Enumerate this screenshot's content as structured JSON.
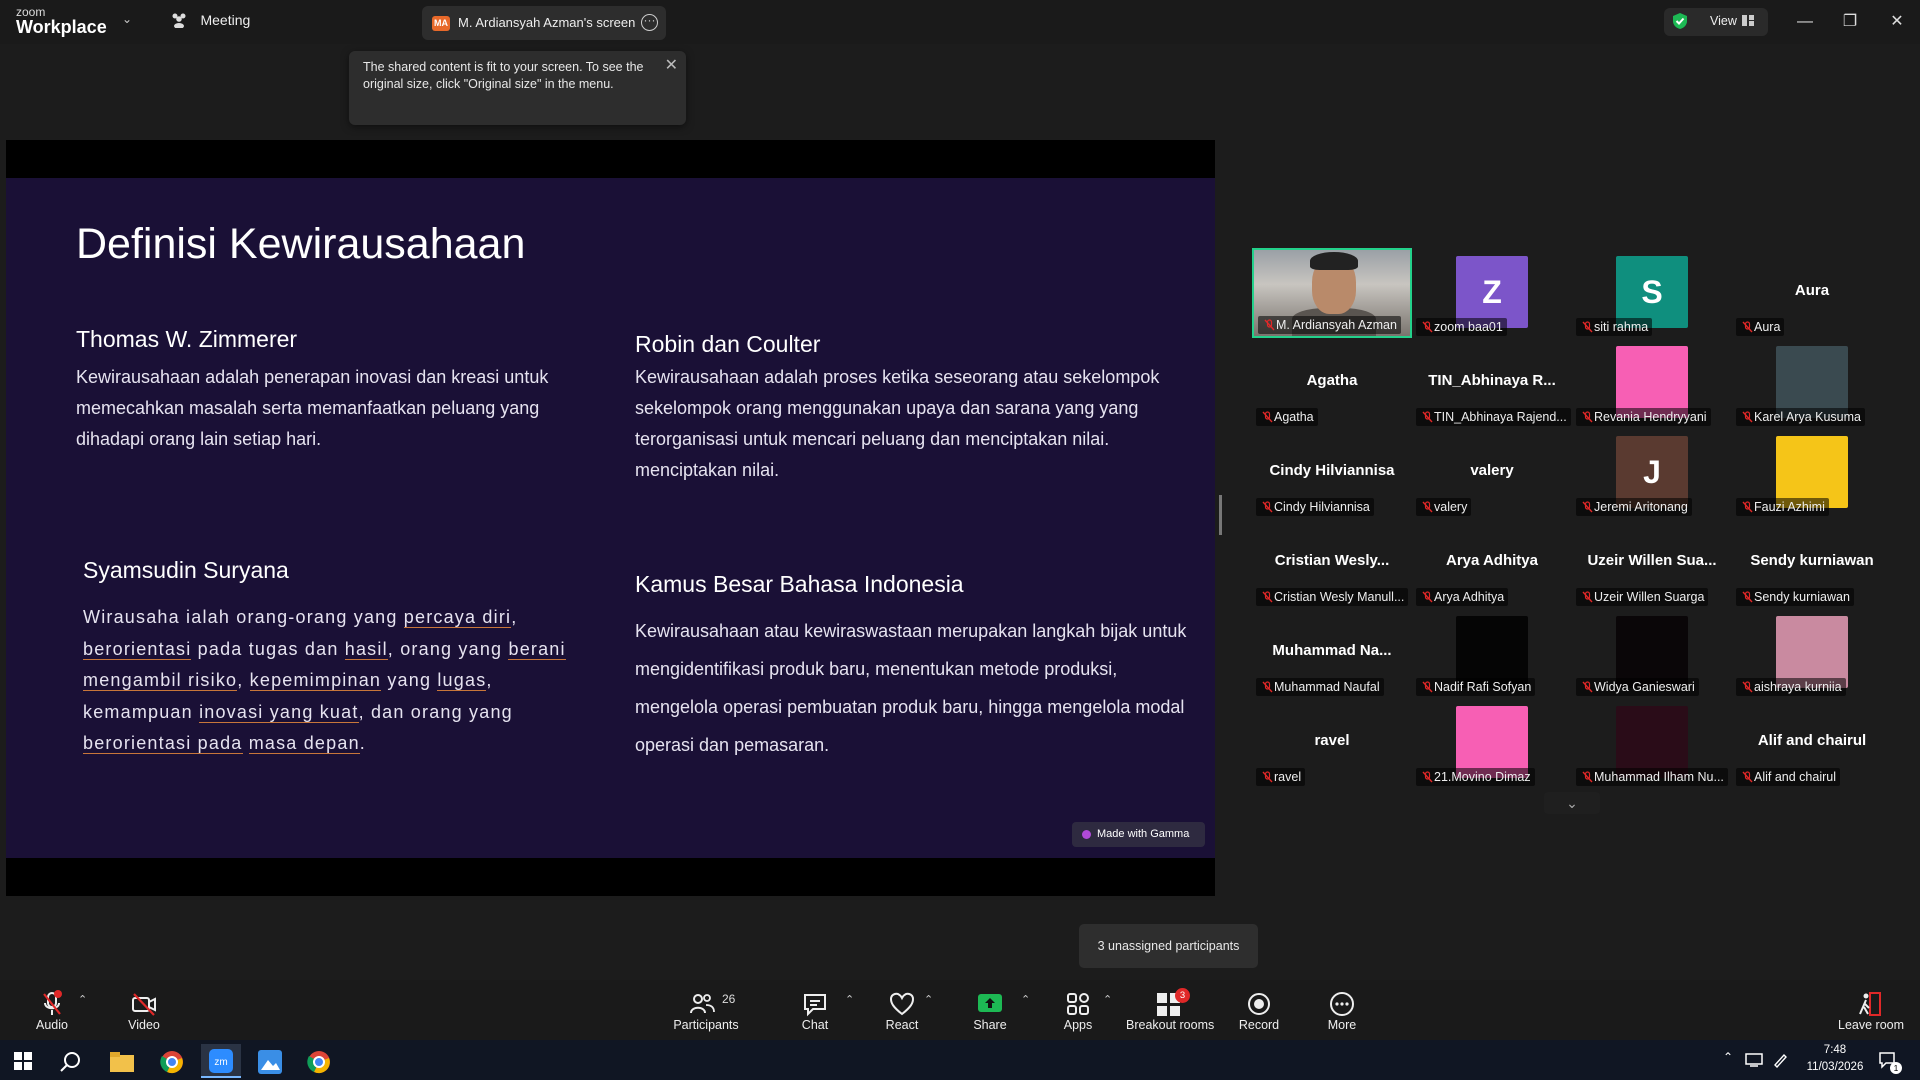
{
  "app": {
    "brand_line1": "zoom",
    "brand_line2": "Workplace",
    "meeting_label": "Meeting",
    "share_tab_initials": "MA",
    "share_tab_label": "M. Ardiansyah Azman's screen",
    "view_label": "View"
  },
  "tooltip": {
    "text": "The shared content is fit to your screen. To see the original size, click \"Original size\" in the menu."
  },
  "slide": {
    "title": "Definisi Kewirausahaan",
    "sections": [
      {
        "heading": "Thomas W. Zimmerer",
        "body": "Kewirausahaan adalah penerapan inovasi dan kreasi untuk memecahkan masalah serta memanfaatkan peluang yang dihadapi orang lain setiap hari."
      },
      {
        "heading": "Robin dan Coulter",
        "body": "Kewirausahaan adalah proses ketika seseorang atau sekelompok sekelompok orang menggunakan upaya dan sarana yang yang terorganisasi untuk mencari peluang dan menciptakan nilai. menciptakan nilai."
      },
      {
        "heading": "Syamsudin Suryana",
        "body_parts": [
          "Wirausaha ialah orang-orang yang ",
          "percaya diri",
          ", ",
          "berorientasi",
          " pada tugas dan ",
          "hasil",
          ", orang yang ",
          "berani mengambil risiko",
          ", ",
          "kepemimpinan",
          " yang ",
          "lugas",
          ", kemampuan ",
          "inovasi yang kuat",
          ", dan orang yang ",
          "berorientasi pada",
          " ",
          "masa depan",
          "."
        ]
      },
      {
        "heading": "Kamus Besar Bahasa Indonesia",
        "body": "Kewirausahaan atau kewiraswastaan merupakan langkah bijak untuk mengidentifikasi produk baru, menentukan metode produksi, mengelola operasi pembuatan produk baru, hingga mengelola modal operasi dan pemasaran."
      }
    ],
    "gamma_badge": "Made with Gamma"
  },
  "participants": [
    {
      "label": "M. Ardiansyah Azman",
      "type": "video",
      "active": true
    },
    {
      "label": "zoom baa01",
      "type": "avatar",
      "letter": "Z",
      "color": "#7c55c9"
    },
    {
      "label": "siti rahma",
      "type": "avatar",
      "letter": "S",
      "color": "#0f8f7e"
    },
    {
      "label": "Aura",
      "type": "name",
      "display": "Aura"
    },
    {
      "label": "Agatha",
      "type": "name",
      "display": "Agatha"
    },
    {
      "label": "TIN_Abhinaya Rajend...",
      "type": "name",
      "display": "TIN_Abhinaya R..."
    },
    {
      "label": "Revania Hendryyani",
      "type": "avatar",
      "letter": "",
      "color": "#f75fb4"
    },
    {
      "label": "Karel Arya Kusuma",
      "type": "photo",
      "color": "#3a4a50"
    },
    {
      "label": "Cindy Hilviannisa",
      "type": "name",
      "display": "Cindy Hilviannisa"
    },
    {
      "label": "valery",
      "type": "name",
      "display": "valery"
    },
    {
      "label": "Jeremi Aritonang",
      "type": "avatar",
      "letter": "J",
      "color": "#5a3a30"
    },
    {
      "label": "Fauzi Azhimi",
      "type": "photo",
      "color": "#f5c518"
    },
    {
      "label": "Cristian Wesly Manull...",
      "type": "name",
      "display": "Cristian Wesly..."
    },
    {
      "label": "Arya Adhitya",
      "type": "name",
      "display": "Arya Adhitya"
    },
    {
      "label": "Uzeir Willen Suarga",
      "type": "name",
      "display": "Uzeir Willen Sua..."
    },
    {
      "label": "Sendy kurniawan",
      "type": "name",
      "display": "Sendy kurniawan"
    },
    {
      "label": "Muhammad Naufal",
      "type": "name",
      "display": "Muhammad Na..."
    },
    {
      "label": "Nadif Rafi Sofyan",
      "type": "avatar",
      "letter": "",
      "color": "#050505"
    },
    {
      "label": "Widya Ganieswari",
      "type": "avatar",
      "letter": "",
      "color": "#0a0608"
    },
    {
      "label": "aishraya kurniia",
      "type": "photo",
      "color": "#c98aa0"
    },
    {
      "label": "ravel",
      "type": "name",
      "display": "ravel"
    },
    {
      "label": "21.Movino Dimaz",
      "type": "avatar",
      "letter": "",
      "color": "#f75fb4"
    },
    {
      "label": "Muhammad Ilham Nu...",
      "type": "avatar",
      "letter": "",
      "color": "#2a0c18"
    },
    {
      "label": "Alif and chairul",
      "type": "name",
      "display": "Alif and chairul"
    }
  ],
  "unassigned": "3 unassigned participants",
  "toolbar": {
    "audio": "Audio",
    "video": "Video",
    "participants": "Participants",
    "participants_count": "26",
    "chat": "Chat",
    "react": "React",
    "share": "Share",
    "apps": "Apps",
    "breakout": "Breakout rooms",
    "breakout_badge": "3",
    "record": "Record",
    "more": "More",
    "leave": "Leave room"
  },
  "taskbar": {
    "time": "7:48",
    "date": "11/03/2026",
    "notif_count": "1"
  },
  "colors": {
    "accent": "#23d18b",
    "slide_bg": "#1a1036",
    "share_green": "#1db954"
  }
}
